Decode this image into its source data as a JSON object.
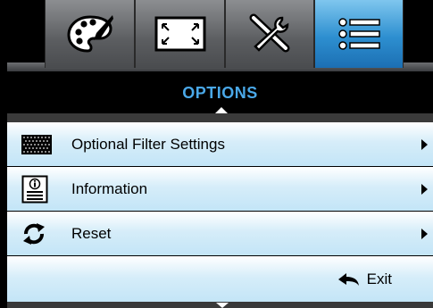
{
  "tabs": [
    {
      "icon": "palette-icon",
      "active": false
    },
    {
      "icon": "display-size-icon",
      "active": false
    },
    {
      "icon": "tools-icon",
      "active": false
    },
    {
      "icon": "options-list-icon",
      "active": true
    }
  ],
  "header": {
    "title": "OPTIONS"
  },
  "menu": {
    "items": [
      {
        "label": "Optional Filter Settings",
        "icon": "filter-icon"
      },
      {
        "label": "Information",
        "icon": "information-icon"
      },
      {
        "label": "Reset",
        "icon": "reset-icon"
      }
    ],
    "exit_label": "Exit"
  },
  "colors": {
    "accent": "#2d8fd0",
    "title": "#4aa8e8",
    "row": "#c3e5f7"
  }
}
